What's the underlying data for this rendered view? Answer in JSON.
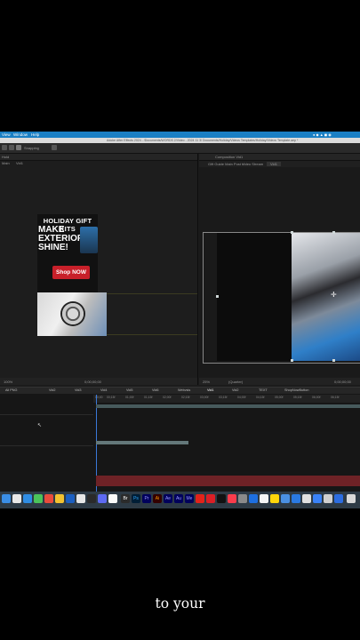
{
  "menubar": {
    "items": [
      "View",
      "Window",
      "Help"
    ]
  },
  "window": {
    "title": "Adobe After Effects 2024 - /Documents/WORDS 2/Video - 2024 11 3/ Documents/Holiday/Videos Templates/Holiday/Videos Template.aep *"
  },
  "toolbar": {
    "snapping_label": "Snapping"
  },
  "left_panel": {
    "header": "Hold",
    "breadcrumb": [
      "Main",
      "Vid1"
    ],
    "ad": {
      "headline": "HOLIDAY GIFT KITS",
      "tagline": "MAKE EXTERIOR SHINE!",
      "cta": "Shop NOW"
    },
    "footer_zoom": "100%",
    "footer_time": "0;00;00;00"
  },
  "right_panel": {
    "header": "Composition Vid1",
    "tabs": [
      "Gift Guide Main Post ×",
      "Video Stream",
      "Vid1"
    ],
    "footer_zoom": "25%",
    "footer_quality": "(Quarter)",
    "footer_time": "0;00;00;00"
  },
  "timeline": {
    "tabs": [
      "All PNG",
      "Vid2",
      "Vid3",
      "Vid4",
      "Vid5",
      "Vid6",
      "Webvsis",
      "Vid1",
      "Vid2",
      "TEXT",
      "ShopNowButton"
    ],
    "ruler": [
      "00;00",
      "00;15f",
      "01;00f",
      "01;15f",
      "02;00f",
      "02;15f",
      "03;00f",
      "03;15f",
      "04;00f",
      "04;15f",
      "05;00f",
      "05;15f",
      "06;00f",
      "06;15f"
    ]
  },
  "dock": {
    "labels": [
      "Br",
      "Ps",
      "Pr",
      "Ai",
      "Ae",
      "Au",
      "Me"
    ]
  },
  "caption": "to your",
  "colors": {
    "menubar": "#1a7fc4",
    "accent_blue": "#2f7fc8",
    "shop_button": "#c8202a",
    "layer_bar": "#64787a",
    "track_red": "#6e2226"
  }
}
